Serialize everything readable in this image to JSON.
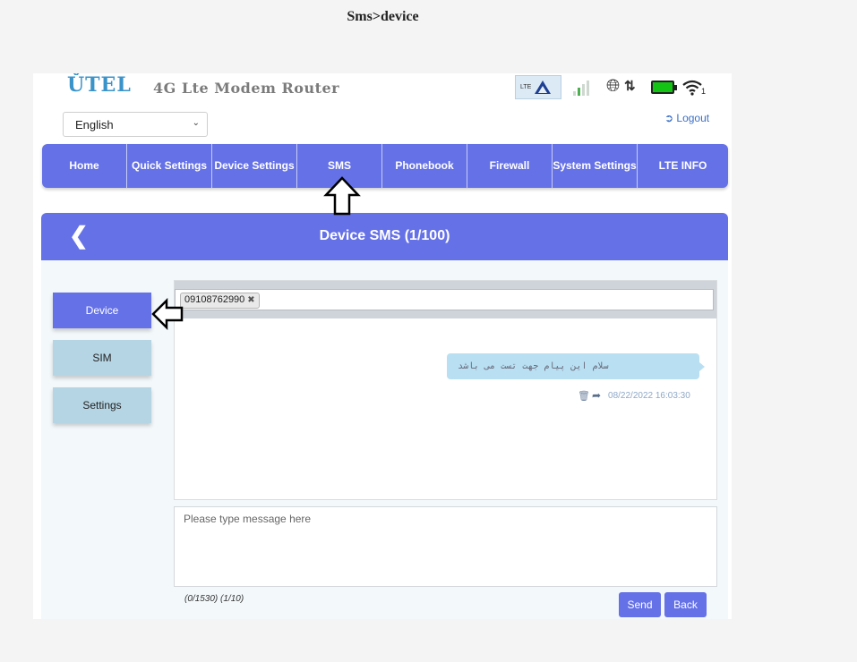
{
  "doc_title": "Sms>device",
  "brand": {
    "logo_text": "ǓTEL",
    "subtitle": "4G Lte Modem Router",
    "accent": "#6571e6"
  },
  "status_bar": {
    "network_label": "LTE",
    "wifi_count": "1",
    "icons": [
      "lte-network-icon",
      "signal-icon",
      "globe-icon",
      "data-arrows-icon",
      "battery-icon",
      "wifi-icon"
    ]
  },
  "language": {
    "selected": "English"
  },
  "logout_label": "Logout",
  "nav": {
    "home": "Home",
    "quick_settings": "Quick Settings",
    "device_settings": "Device Settings",
    "sms": "SMS",
    "phonebook": "Phonebook",
    "firewall": "Firewall",
    "system_settings": "System Settings",
    "lte_info": "LTE INFO"
  },
  "sms": {
    "header_title": "Device SMS (1/100)",
    "sidebar": {
      "device": "Device",
      "sim": "SIM",
      "settings": "Settings"
    },
    "recipient": "09108762990",
    "message": {
      "text": "سلام این پیام جهت تست می باشد",
      "timestamp": "08/22/2022 16:03:30"
    },
    "input_placeholder": "Please type message here",
    "counter": "(0/1530) (1/10)",
    "send_label": "Send",
    "back_label": "Back"
  }
}
